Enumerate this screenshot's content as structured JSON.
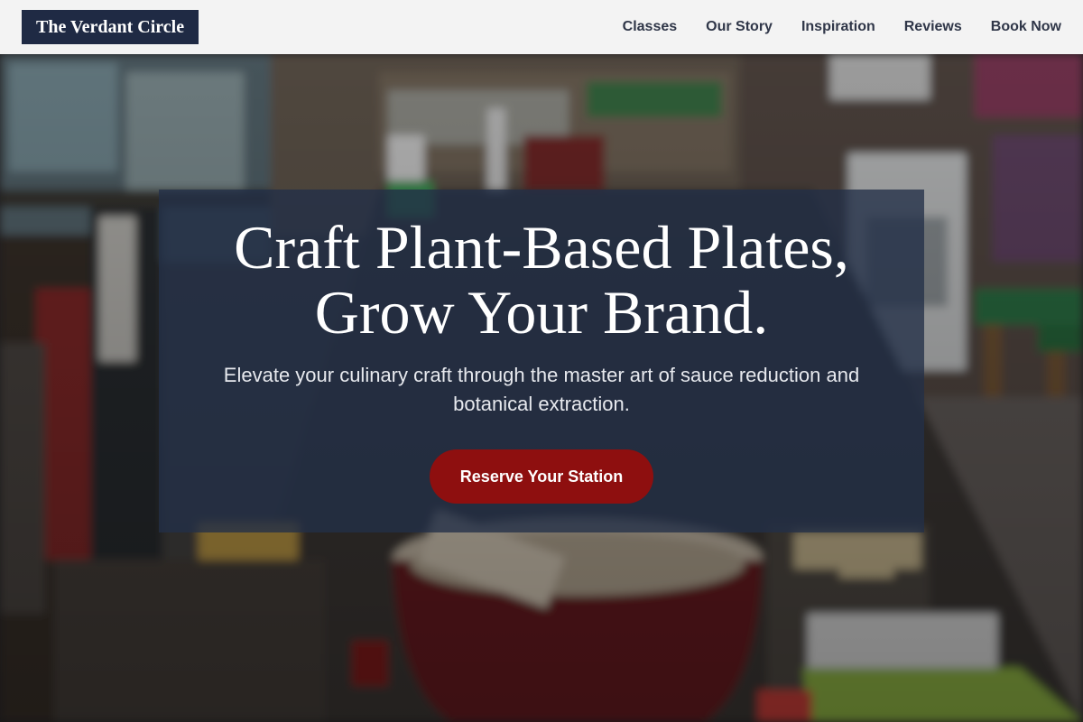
{
  "header": {
    "brand": "The Verdant Circle",
    "nav": [
      {
        "label": "Classes"
      },
      {
        "label": "Our Story"
      },
      {
        "label": "Inspiration"
      },
      {
        "label": "Reviews"
      },
      {
        "label": "Book Now"
      }
    ]
  },
  "hero": {
    "headline_line1": "Craft Plant-Based Plates,",
    "headline_line2": "Grow Your Brand.",
    "subtitle": "Elevate your culinary craft through the master art of sauce reduction and botanical extraction.",
    "cta_label": "Reserve Your Station"
  },
  "colors": {
    "brand_bg": "#1f2a44",
    "panel_bg": "#222f48",
    "cta": "#8e0f0f",
    "nav_text": "#2f3648"
  }
}
